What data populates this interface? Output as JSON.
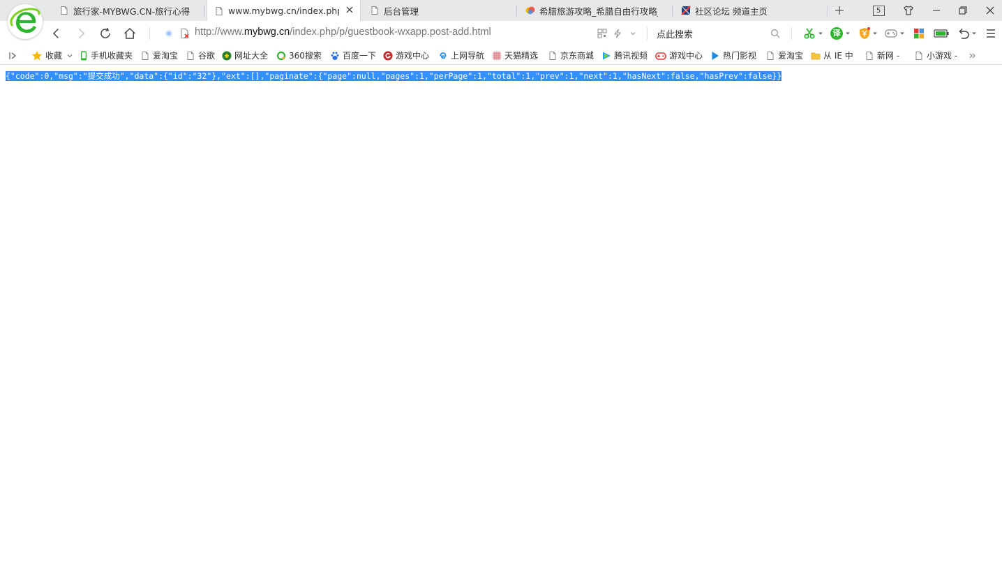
{
  "browser": {
    "tabs": [
      {
        "label": "旅行家-MYBWG.CN-旅行心得",
        "icon": "page-icon"
      },
      {
        "label": "www.mybwg.cn/index.php/p/guestbook-wxapp.post-add.html",
        "icon": "page-icon",
        "active": true
      },
      {
        "label": "后台管理",
        "icon": "page-icon"
      },
      {
        "label": "希腊旅游攻略_希腊自由行攻略_",
        "icon": "colorful-bubble-icon"
      },
      {
        "label": "社区论坛 频道主页",
        "icon": "forum-icon"
      }
    ],
    "tab_count": "5"
  },
  "navbar": {
    "url_scheme": "http://www.",
    "url_host": "mybwg.cn",
    "url_path": "/index.php/p/guestbook-wxapp.post-add.html",
    "search_placeholder": "点此搜索",
    "translate_label": "译"
  },
  "bookmarks": [
    {
      "label": "收藏",
      "icon": "star-icon"
    },
    {
      "label": "手机收藏夹",
      "icon": "phone-icon"
    },
    {
      "label": "爱淘宝",
      "icon": "page-icon"
    },
    {
      "label": "谷歌",
      "icon": "page-icon"
    },
    {
      "label": "网址大全",
      "icon": "site-nav-icon"
    },
    {
      "label": "360搜索",
      "icon": "search-360-icon"
    },
    {
      "label": "百度一下",
      "icon": "baidu-paw-icon"
    },
    {
      "label": "游戏中心",
      "icon": "game-g-icon"
    },
    {
      "label": "上网导航",
      "icon": "ie-icon"
    },
    {
      "label": "天猫精选",
      "icon": "tmall-icon"
    },
    {
      "label": "京东商城",
      "icon": "page-icon"
    },
    {
      "label": "腾讯视频",
      "icon": "play-icon"
    },
    {
      "label": "游戏中心",
      "icon": "gamepad-icon"
    },
    {
      "label": "热门影视",
      "icon": "video-icon"
    },
    {
      "label": "爱淘宝",
      "icon": "page-icon"
    },
    {
      "label": "从 IE 中",
      "icon": "folder-icon"
    },
    {
      "label": "新网 -",
      "icon": "page-icon"
    },
    {
      "label": "小游戏 -",
      "icon": "page-icon"
    }
  ],
  "content": {
    "json_text": "{\"code\":0,\"msg\":\"提交成功\",\"data\":{\"id\":\"32\"},\"ext\":[],\"paginate\":{\"page\":null,\"pages\":1,\"perPage\":1,\"total\":1,\"prev\":1,\"next\":1,\"hasNext\":false,\"hasPrev\":false}}"
  },
  "colors": {
    "selection": "#3390ff",
    "brand_green": "#2fb62f",
    "tabstrip": "#e7e8ea"
  }
}
